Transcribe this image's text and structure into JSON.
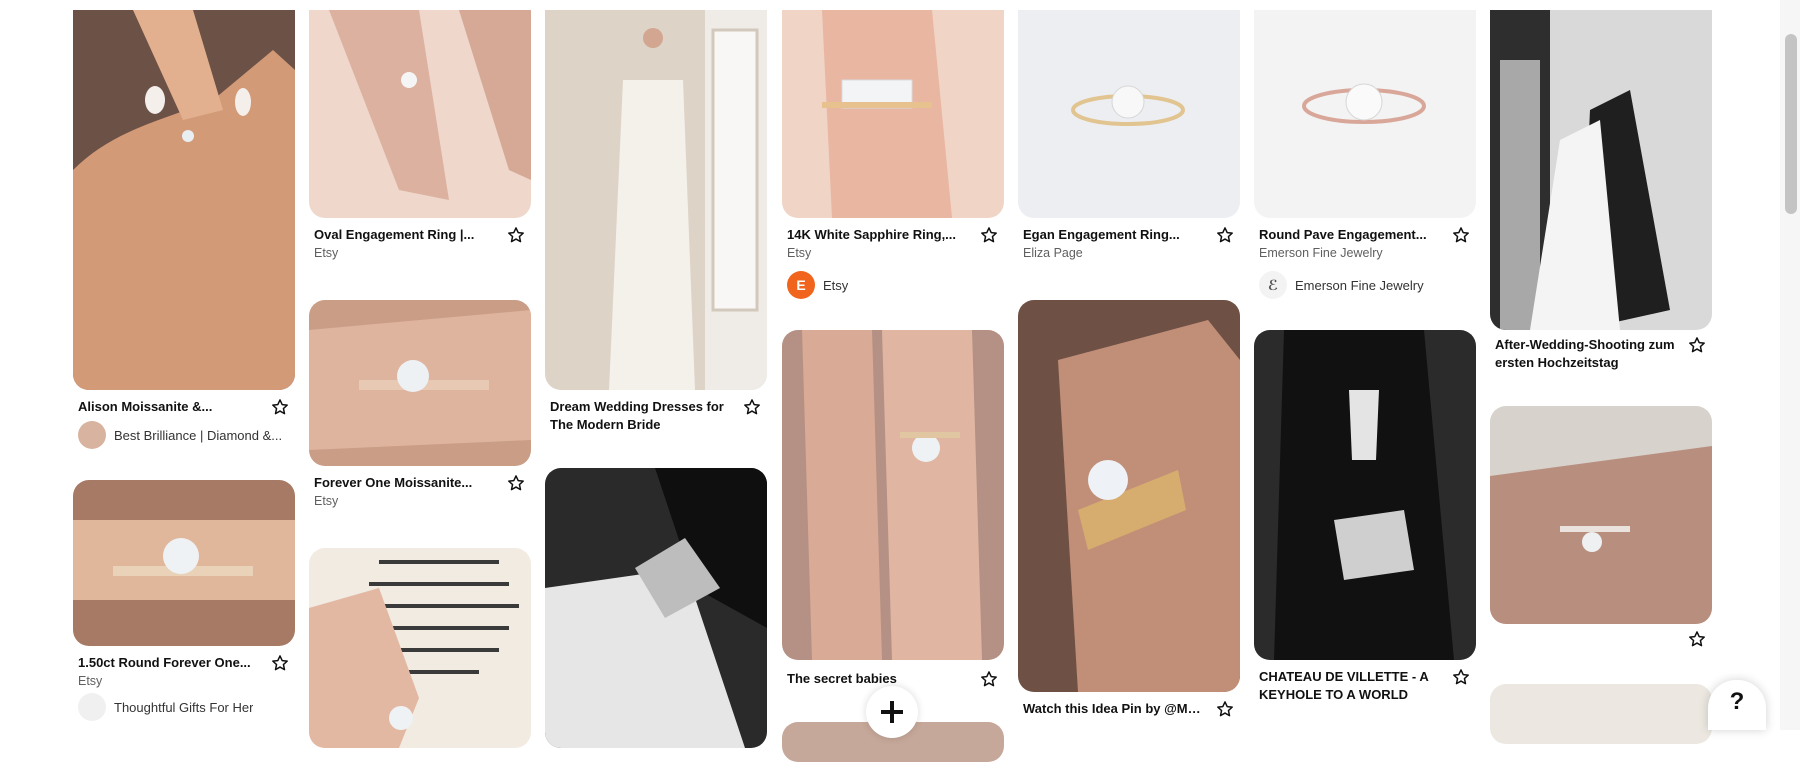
{
  "pins": {
    "c1p1": {
      "title": "Alison Moissanite &...",
      "author": "Best Brilliance | Diamond &..."
    },
    "c1p2": {
      "title": "1.50ct Round Forever One...",
      "source": "Etsy",
      "author": "Thoughtful Gifts For Her"
    },
    "c2p1": {
      "title": "Oval Engagement Ring |...",
      "source": "Etsy"
    },
    "c2p2": {
      "title": "Forever One Moissanite...",
      "source": "Etsy"
    },
    "c3p1": {
      "title": "Dream Wedding Dresses for The Modern Bride"
    },
    "c4p1": {
      "title": "14K White Sapphire Ring,...",
      "source": "Etsy",
      "author": "Etsy",
      "avatar_letter": "E"
    },
    "c4p2": {
      "title": "The secret babies"
    },
    "c5p1": {
      "title": "Egan Engagement Ring...",
      "source": "Eliza Page"
    },
    "c5p2": {
      "title": "Watch this Idea Pin by @Marrowfine : White..."
    },
    "c6p1": {
      "title": "Round Pave Engagement...",
      "source": "Emerson Fine Jewelry",
      "author": "Emerson Fine Jewelry"
    },
    "c6p2": {
      "title": "CHATEAU DE VILLETTE - A KEYHOLE TO A WORLD LO..."
    },
    "c7p1": {
      "title": "After-Wedding-Shooting zum ersten Hochzeitstag"
    }
  },
  "floating": {
    "help_label": "?",
    "add_label": "+"
  },
  "colors": {
    "etsy_orange": "#f1641e",
    "text": "#111111",
    "muted": "#5f5f5f"
  },
  "icons": {
    "save": "star-outline-icon",
    "help": "question-icon",
    "add": "plus-icon"
  }
}
